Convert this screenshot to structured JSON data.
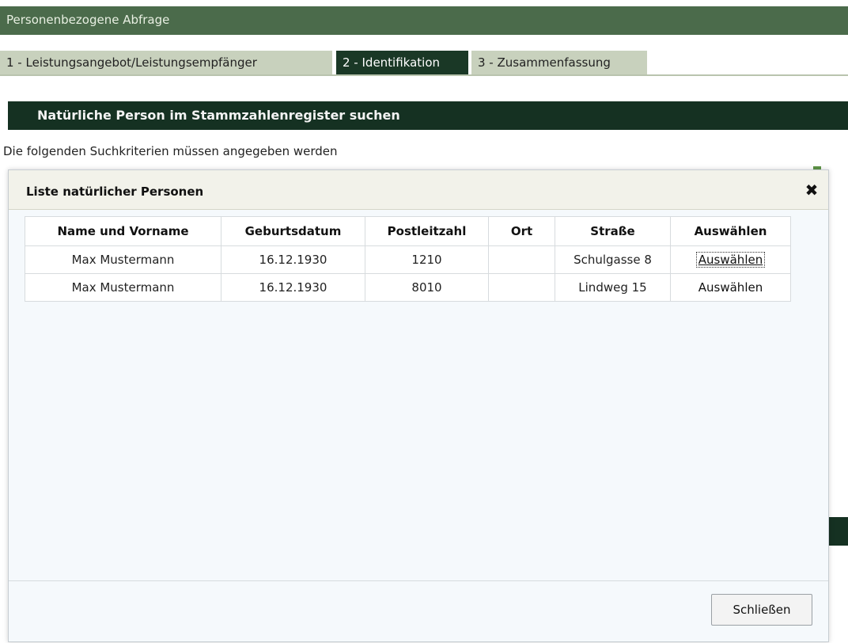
{
  "header": {
    "title": "Personenbezogene Abfrage"
  },
  "tabs": [
    {
      "label": "1 - Leistungsangebot/Leistungsempfänger"
    },
    {
      "label": "2 - Identifikation",
      "active": true
    },
    {
      "label": "3 - Zusammenfassung"
    }
  ],
  "section": {
    "title": "Natürliche Person im Stammzahlenregister suchen",
    "hint": "Die folgenden Suchkriterien müssen angegeben werden"
  },
  "modal": {
    "title": "Liste natürlicher Personen",
    "close_icon": "close-x-icon",
    "columns": [
      "Name und Vorname",
      "Geburtsdatum",
      "Postleitzahl",
      "Ort",
      "Straße",
      "Auswählen"
    ],
    "rows": [
      {
        "name": "Max Mustermann",
        "birthdate": "16.12.1930",
        "zip": "1210",
        "city": "",
        "street": "Schulgasse 8",
        "action": "Auswählen"
      },
      {
        "name": "Max Mustermann",
        "birthdate": "16.12.1930",
        "zip": "8010",
        "city": "",
        "street": "Lindweg 15",
        "action": "Auswählen"
      }
    ],
    "close_button": "Schließen"
  },
  "colors": {
    "header_bg": "#4b6b4b",
    "section_bg": "#153122",
    "tab_active_bg": "#1a3826",
    "tab_inactive_bg": "#c8d1bd"
  }
}
